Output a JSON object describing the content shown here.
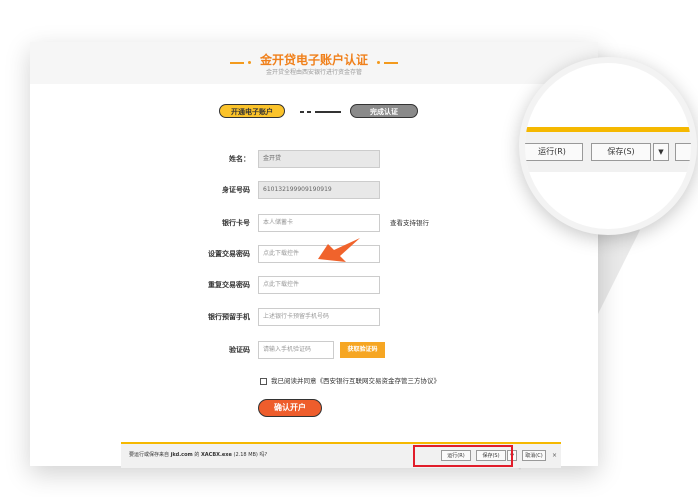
{
  "header": {
    "title": "金开贷电子账户认证",
    "subtitle": "金开贷全程由西安银行进行资金存管"
  },
  "steps": {
    "step1": "开通电子账户",
    "step2": "完成认证"
  },
  "form": {
    "name": {
      "label": "姓名：",
      "value": "金开贷"
    },
    "id_number": {
      "label": "身证号码",
      "value": "610132199909190919"
    },
    "bank_card": {
      "label": "银行卡号",
      "placeholder": "本人储蓄卡",
      "link": "查看支持银行"
    },
    "set_password": {
      "label": "设置交易密码",
      "placeholder": "点此下载控件"
    },
    "repeat_password": {
      "label": "重复交易密码",
      "placeholder": "点此下载控件"
    },
    "bank_phone": {
      "label": "银行预留手机",
      "placeholder": "上述银行卡预留手机号码"
    },
    "verify_code": {
      "label": "验证码",
      "placeholder": "请输入手机验证码",
      "button": "获取验证码"
    },
    "agreement": "我已阅读并同意《西安银行互联网交易资金存管三方协议》",
    "submit": "确认开户"
  },
  "download_bar": {
    "message_prefix": "要运行或保存来自",
    "site": "jkd.com",
    "message_mid": "的",
    "file": "XACBX.exe",
    "size": "(2.18 MB)",
    "message_suffix": "吗?",
    "run": "运行(R)",
    "save": "保存(S)",
    "dropdown": "▼",
    "cancel": "取消(C)",
    "close": "×"
  },
  "zoom": {
    "run": "运行(R)",
    "save": "保存(S)",
    "dropdown": "▼"
  },
  "colors": {
    "accent_orange": "#f0801b",
    "step_active": "#fbc32a",
    "submit": "#ee5d2c",
    "highlight_red": "#e11d2a",
    "arrow": "#f0632c"
  }
}
